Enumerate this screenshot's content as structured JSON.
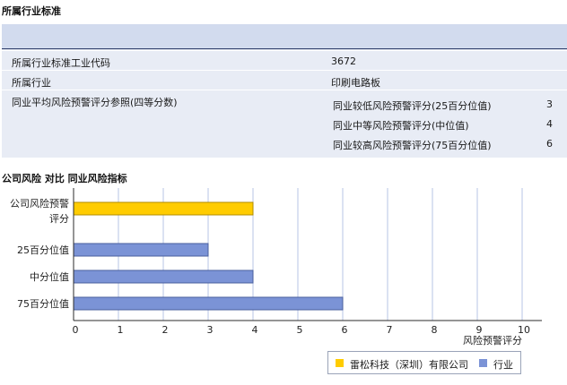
{
  "industry_section": {
    "title": "所属行业标准",
    "rows": [
      {
        "label": "所属行业标准工业代码",
        "value": "3672"
      },
      {
        "label": "所属行业",
        "value": "印刷电路板"
      }
    ],
    "avg_row": {
      "label": "同业平均风险预警评分参照(四等分数)",
      "items": [
        {
          "label": "同业较低风险预警评分(25百分位值)",
          "value": "3"
        },
        {
          "label": "同业中等风险预警评分(中位值)",
          "value": "4"
        },
        {
          "label": "同业较高风险预警评分(75百分位值)",
          "value": "6"
        }
      ]
    }
  },
  "chart_section": {
    "title": "公司风险 对比 同业风险指标"
  },
  "chart_data": {
    "type": "bar",
    "orientation": "horizontal",
    "categories": [
      "公司风险预警评分",
      "25百分位值",
      "中分位值",
      "75百分位值"
    ],
    "category_labels": [
      [
        "公司风险预警",
        "评分"
      ],
      [
        "25百分位值"
      ],
      [
        "中分位值"
      ],
      [
        "75百分位值"
      ]
    ],
    "series": [
      {
        "name": "雷松科技（深圳）有限公司",
        "color": "#ffcc00",
        "values": [
          4,
          null,
          null,
          null
        ]
      },
      {
        "name": "行业",
        "color": "#7b93d6",
        "values": [
          null,
          3,
          4,
          6
        ]
      }
    ],
    "xlim": [
      0,
      10
    ],
    "xticks": [
      0,
      1,
      2,
      3,
      4,
      5,
      6,
      7,
      8,
      9,
      10
    ],
    "xlabel": "风险预警评分",
    "grid": true,
    "legend_position": "bottom-right"
  }
}
